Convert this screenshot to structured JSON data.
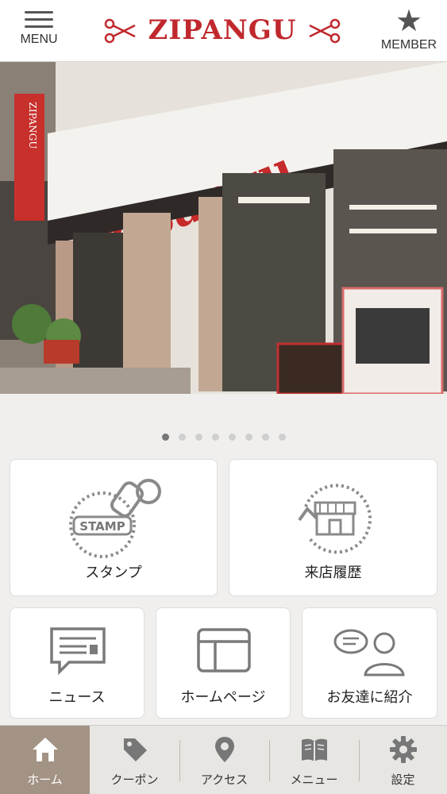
{
  "header": {
    "menu_label": "MENU",
    "logo_text": "ZIPANGU",
    "member_label": "MEMBER"
  },
  "hero": {
    "sign_text": "zipangu",
    "banner_text": "ZIPANGU",
    "slide_count": 8,
    "active_slide": 1
  },
  "tiles": {
    "stamp": {
      "label": "スタンプ",
      "icon_text": "STAMP"
    },
    "visit_history": {
      "label": "来店履歴"
    },
    "news": {
      "label": "ニュース"
    },
    "homepage": {
      "label": "ホームページ"
    },
    "refer_friend": {
      "label": "お友達に紹介"
    }
  },
  "bottom_nav": {
    "items": [
      {
        "label": "ホーム",
        "icon": "home-icon",
        "active": true
      },
      {
        "label": "クーポン",
        "icon": "tag-icon",
        "active": false
      },
      {
        "label": "アクセス",
        "icon": "map-pin-icon",
        "active": false
      },
      {
        "label": "メニュー",
        "icon": "book-icon",
        "active": false
      },
      {
        "label": "設定",
        "icon": "gear-icon",
        "active": false
      }
    ]
  },
  "colors": {
    "brand_red": "#c0282d",
    "active_nav": "#a39384",
    "icon_gray": "#7a7a7a"
  }
}
